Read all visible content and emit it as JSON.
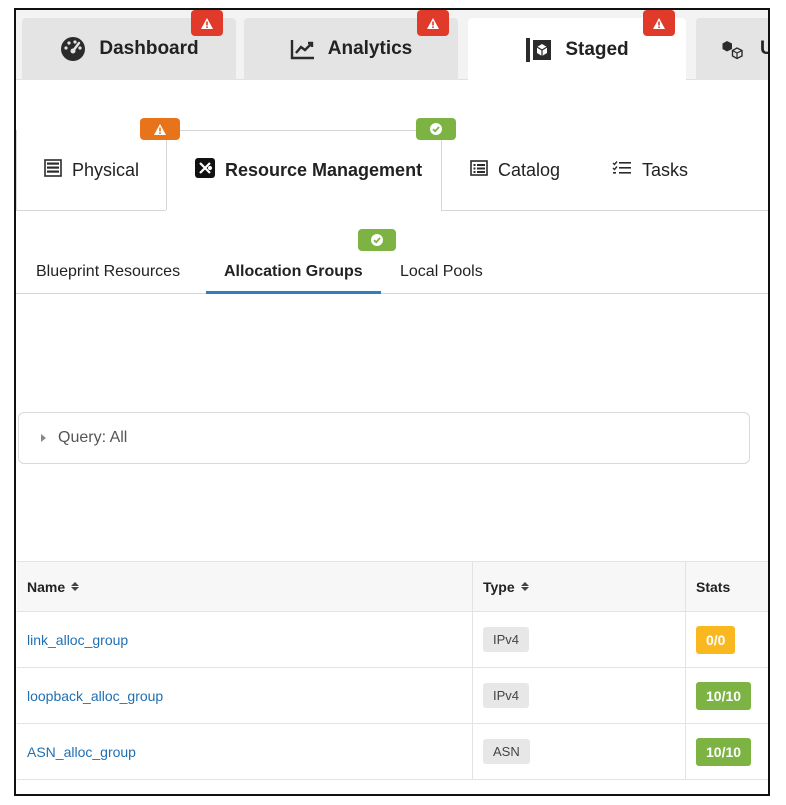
{
  "top_tabs": [
    {
      "label": "Dashboard",
      "icon": "speedometer-icon"
    },
    {
      "label": "Analytics",
      "icon": "line-chart-icon"
    },
    {
      "label": "Staged",
      "icon": "staged-cube-icon",
      "active": true
    },
    {
      "label": "U",
      "icon": "cubes-icon"
    }
  ],
  "mid_tabs": [
    {
      "label": "Physical",
      "icon": "rack-icon"
    },
    {
      "label": "Resource Management",
      "icon": "resource-x-icon",
      "active": true
    },
    {
      "label": "Catalog",
      "icon": "list-box-icon"
    },
    {
      "label": "Tasks",
      "icon": "task-list-icon"
    }
  ],
  "sub_tabs": [
    {
      "label": "Blueprint Resources"
    },
    {
      "label": "Allocation Groups",
      "active": true
    },
    {
      "label": "Local Pools"
    }
  ],
  "query": {
    "label": "Query: All"
  },
  "table": {
    "headers": {
      "name": "Name",
      "type": "Type",
      "stats": "Stats"
    },
    "rows": [
      {
        "name": "link_alloc_group",
        "type": "IPv4",
        "stats": "0/0",
        "stats_color": "#f9b820"
      },
      {
        "name": "loopback_alloc_group",
        "type": "IPv4",
        "stats": "10/10",
        "stats_color": "#7cb342"
      },
      {
        "name": "ASN_alloc_group",
        "type": "ASN",
        "stats": "10/10",
        "stats_color": "#7cb342"
      }
    ]
  },
  "colors": {
    "warning_red": "#e03b2a",
    "warning_orange": "#e7731b",
    "ok_green": "#7cb342",
    "link_blue": "#1f6fb3",
    "active_underline": "#2f80c2"
  }
}
